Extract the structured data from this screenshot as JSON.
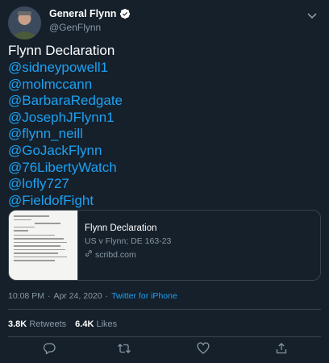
{
  "user": {
    "display_name": "General Flynn",
    "handle": "@GenFlynn",
    "verified": true
  },
  "tweet": {
    "title": "Flynn Declaration",
    "mentions": [
      "@sidneypowell1",
      "@molmccann",
      "@BarbaraRedgate",
      "@JosephJFlynn1",
      "@flynn_neill",
      "@GoJackFlynn",
      "@76LibertyWatch",
      "@lofly727",
      "@FieldofFight"
    ]
  },
  "card": {
    "title": "Flynn Declaration",
    "description": "US v Flynn; DE 163-23",
    "domain": "scribd.com"
  },
  "meta": {
    "time": "10:08 PM",
    "separator": "·",
    "date": "Apr 24, 2020",
    "separator2": "·",
    "source": "Twitter for iPhone"
  },
  "stats": {
    "retweets_count": "3.8K",
    "retweets_label": "Retweets",
    "likes_count": "6.4K",
    "likes_label": "Likes"
  },
  "icons": {
    "reply": "reply-icon",
    "retweet": "retweet-icon",
    "like": "heart-icon",
    "share": "share-icon",
    "menu": "chevron-down-icon",
    "link": "link-icon"
  },
  "colors": {
    "background": "#15202b",
    "link": "#1da1f2",
    "muted": "#8899a6",
    "border": "#38444d"
  }
}
